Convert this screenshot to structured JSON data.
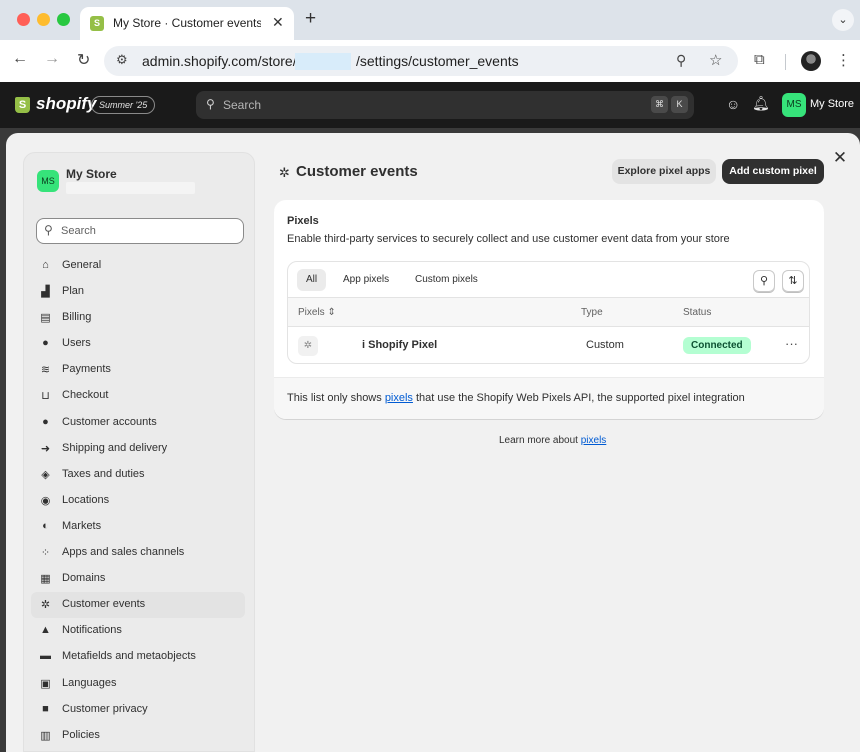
{
  "browser": {
    "tab_title": "My Store · Customer events ·",
    "url_prefix": "admin.shopify.com/store/",
    "url_suffix": "/settings/customer_events"
  },
  "topbar": {
    "logo_text": "shopify",
    "edition": "Summer '25",
    "search_placeholder": "Search",
    "shortcut_cmd": "⌘",
    "shortcut_key": "K",
    "store_initials": "MS",
    "store_name": "My Store"
  },
  "sidebar": {
    "store_initials": "MS",
    "store_name": "My Store",
    "search_placeholder": "Search",
    "items": [
      {
        "label": "General",
        "icon": "store-icon"
      },
      {
        "label": "Plan",
        "icon": "plan-icon"
      },
      {
        "label": "Billing",
        "icon": "billing-icon"
      },
      {
        "label": "Users",
        "icon": "users-icon"
      },
      {
        "label": "Payments",
        "icon": "payments-icon"
      },
      {
        "label": "Checkout",
        "icon": "cart-icon"
      },
      {
        "label": "Customer accounts",
        "icon": "person-icon"
      },
      {
        "label": "Shipping and delivery",
        "icon": "truck-icon"
      },
      {
        "label": "Taxes and duties",
        "icon": "tax-icon"
      },
      {
        "label": "Locations",
        "icon": "location-icon"
      },
      {
        "label": "Markets",
        "icon": "globe-icon"
      },
      {
        "label": "Apps and sales channels",
        "icon": "apps-icon"
      },
      {
        "label": "Domains",
        "icon": "domain-icon"
      },
      {
        "label": "Customer events",
        "icon": "sparkle-icon",
        "active": true
      },
      {
        "label": "Notifications",
        "icon": "bell-icon"
      },
      {
        "label": "Metafields and metaobjects",
        "icon": "metafields-icon"
      },
      {
        "label": "Languages",
        "icon": "language-icon"
      },
      {
        "label": "Customer privacy",
        "icon": "lock-icon"
      },
      {
        "label": "Policies",
        "icon": "policy-icon"
      }
    ]
  },
  "main": {
    "title": "Customer events",
    "explore_button": "Explore pixel apps",
    "add_button": "Add custom pixel",
    "card": {
      "title": "Pixels",
      "description": "Enable third-party services to securely collect and use customer event data from your store",
      "tabs": [
        "All",
        "App pixels",
        "Custom pixels"
      ],
      "columns": {
        "pixels": "Pixels",
        "type": "Type",
        "status": "Status"
      },
      "rows": [
        {
          "name": "i Shopify Pixel",
          "type": "Custom",
          "status": "Connected"
        }
      ],
      "footer_before": "This list only shows ",
      "footer_link": "pixels",
      "footer_after": " that use the Shopify Web Pixels API, the supported pixel integration"
    },
    "learn_more_text": "Learn more about ",
    "learn_more_link": "pixels"
  },
  "colors": {
    "brand_green": "#95bf47",
    "avatar_green": "#36e37a",
    "primary_button": "#303030",
    "status_connected_bg": "#b4fed2",
    "link": "#005bd3"
  }
}
